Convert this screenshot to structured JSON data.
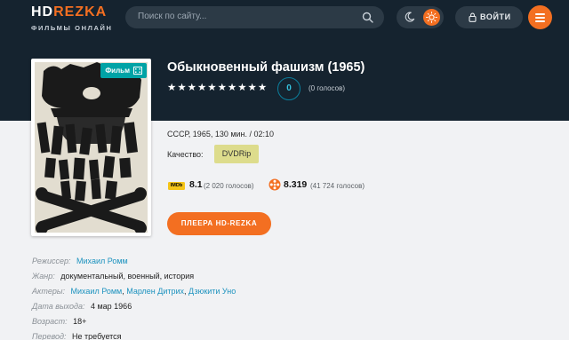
{
  "header": {
    "logo": {
      "hd": "HD",
      "rezka": "REZKA",
      "subtitle": "ФИЛЬМЫ ОНЛАЙН"
    },
    "search": {
      "placeholder": "Поиск по сайту..."
    },
    "login_label": "ВОЙТИ"
  },
  "movie": {
    "title": "Обыкновенный фашизм (1965)",
    "badge": "Фильм",
    "stars": [
      "★",
      "★",
      "★",
      "★",
      "★",
      "★",
      "★",
      "★",
      "★",
      "★"
    ],
    "rating_score": "0",
    "rating_votes": "(0 голосов)",
    "meta": "СССР, 1965, 130 мин. / 02:10",
    "quality_label": "Качество:",
    "quality": "DVDRip",
    "imdb": {
      "logo": "IMDb",
      "value": "8.1",
      "votes": "(2 020 голосов)"
    },
    "kinopoisk": {
      "value": "8.319",
      "votes": "(41 724 голосов)"
    },
    "play_button": "ПЛЕЕРА HD-REZKA",
    "details": {
      "director_label": "Режиссер:",
      "director": "Михаил Ромм",
      "genre_label": "Жанр:",
      "genre": "документальный, военный, история",
      "actors_label": "Актеры:",
      "actors": [
        "Михаил Ромм",
        "Марлен Дитрих",
        "Дзюкити Уно"
      ],
      "release_label": "Дата выхода:",
      "release": "4 мар 1966",
      "age_label": "Возраст:",
      "age": "18+",
      "translation_label": "Перевод:",
      "translation": "Не требуется"
    }
  },
  "colors": {
    "accent": "#f36f21",
    "dark": "#15232f",
    "link": "#1d93bf",
    "badge": "#00a3a6",
    "quality": "#dddc8c"
  }
}
